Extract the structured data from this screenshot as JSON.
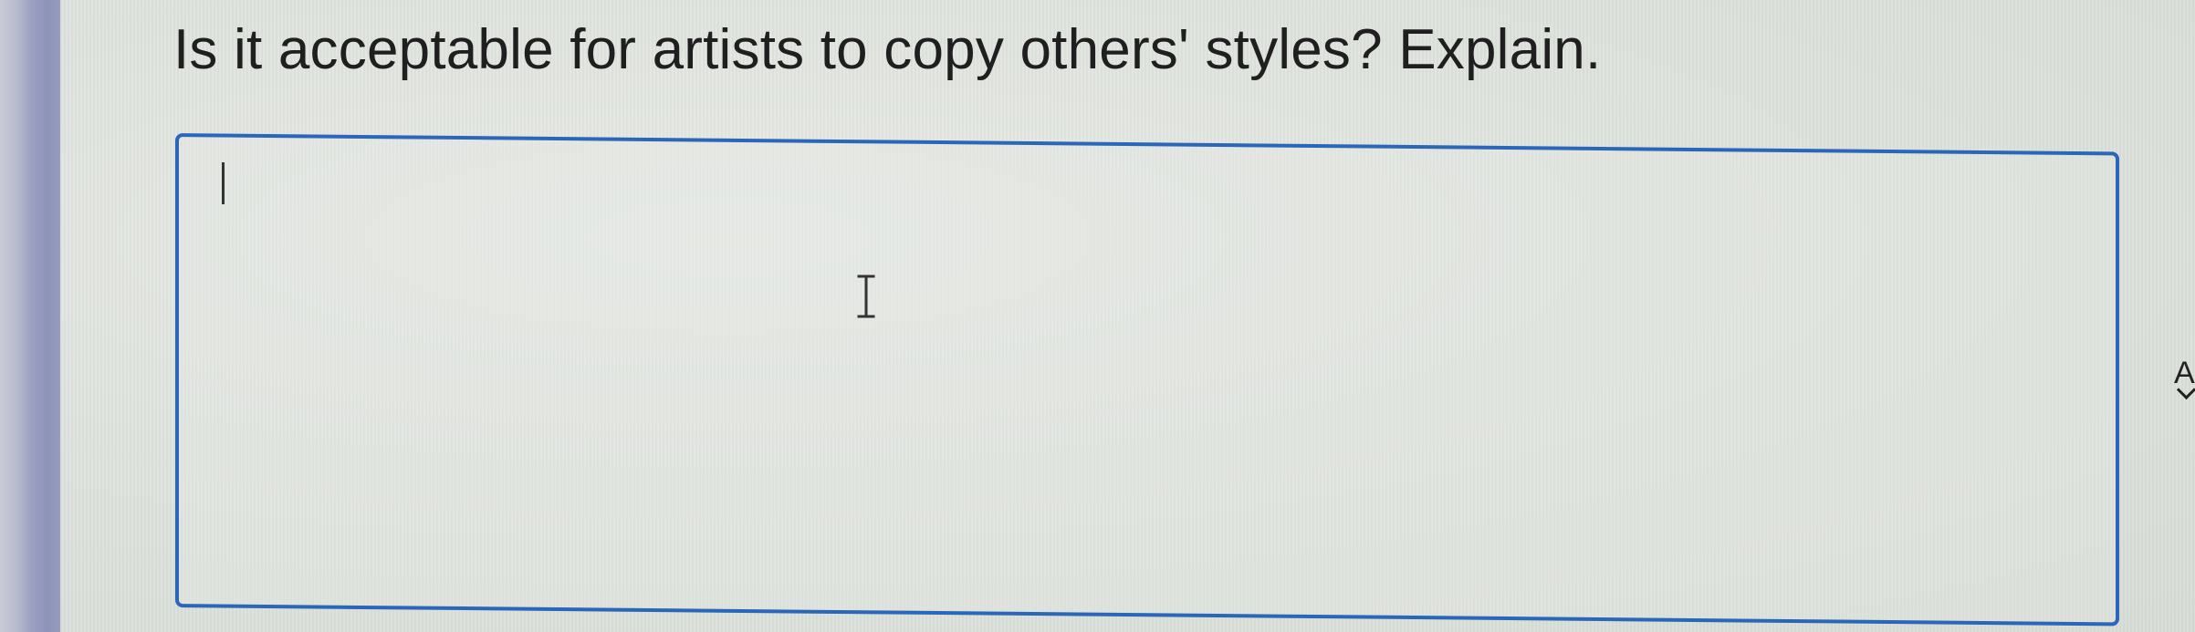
{
  "question": {
    "text": "Is it acceptable for artists to copy others' styles? Explain."
  },
  "answer_box": {
    "value": ""
  },
  "edge_widget": {
    "label": "A"
  },
  "colors": {
    "accent": "#2a67b8",
    "text": "#1f1f1f",
    "sidebar": "#979cbe"
  },
  "icons": {
    "text_cursor": "i-beam-cursor-icon",
    "collapse": "chevron-down-icon"
  }
}
